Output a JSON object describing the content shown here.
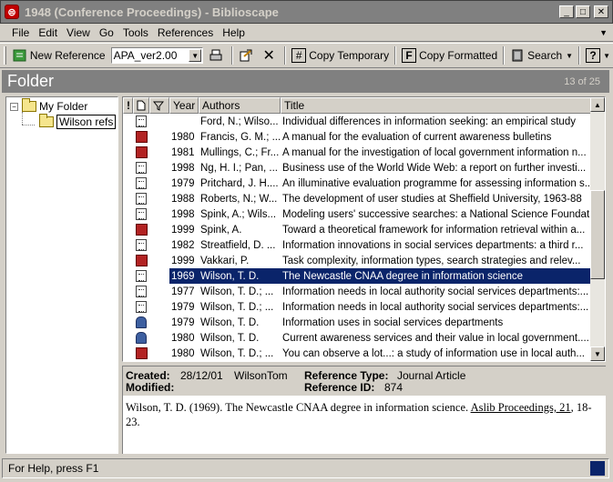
{
  "window": {
    "title": "1948  (Conference Proceedings) - Biblioscape",
    "controls": {
      "minimize": "_",
      "maximize": "□",
      "close": "✕"
    }
  },
  "menu": {
    "items": [
      {
        "label": "File"
      },
      {
        "label": "Edit"
      },
      {
        "label": "View"
      },
      {
        "label": "Go"
      },
      {
        "label": "Tools"
      },
      {
        "label": "References"
      },
      {
        "label": "Help"
      }
    ]
  },
  "toolbar": {
    "new_reference": "New Reference",
    "style_value": "APA_ver2.00",
    "copy_temporary": "Copy Temporary",
    "copy_formatted": "Copy Formatted",
    "search": "Search"
  },
  "folder": {
    "title": "Folder",
    "count": "13 of 25"
  },
  "tree": {
    "root": "My Folder",
    "child": "Wilson refs",
    "expander": "−"
  },
  "grid": {
    "headers": {
      "flag": "!",
      "type": "",
      "attach": "",
      "year": "Year",
      "authors": "Authors",
      "title": "Title"
    },
    "rows": [
      {
        "icon": "doc",
        "year": "",
        "authors": "Ford, N.; Wilso...",
        "title": "Individual differences in information seeking: an empirical study"
      },
      {
        "icon": "book",
        "year": "1980",
        "authors": "Francis, G. M.; ...",
        "title": "A manual for the evaluation of current awareness bulletins"
      },
      {
        "icon": "book",
        "year": "1981",
        "authors": "Mullings, C.; Fr...",
        "title": "A manual for the investigation of local government information n..."
      },
      {
        "icon": "doc",
        "year": "1998",
        "authors": "Ng, H. I.; Pan, ...",
        "title": "Business use of the World Wide Web: a report on further investi..."
      },
      {
        "icon": "doc",
        "year": "1979",
        "authors": "Pritchard, J. H....",
        "title": "An illuminative evaluation programme for assessing information s..."
      },
      {
        "icon": "doc",
        "year": "1988",
        "authors": "Roberts, N.; W...",
        "title": "The development of user studies at Sheffield University, 1963-88"
      },
      {
        "icon": "doc",
        "year": "1998",
        "authors": "Spink, A.; Wils...",
        "title": "Modeling users' successive searches: a National Science Foundat..."
      },
      {
        "icon": "book",
        "year": "1999",
        "authors": "Spink, A.",
        "title": "Toward a theoretical framework for information retrieval within a..."
      },
      {
        "icon": "doc",
        "year": "1982",
        "authors": "Streatfield, D. ...",
        "title": "Information innovations in social services departments: a third r..."
      },
      {
        "icon": "book",
        "year": "1999",
        "authors": "Vakkari, P.",
        "title": "Task complexity, information types, search strategies and relev..."
      },
      {
        "icon": "doc",
        "year": "1969",
        "authors": "Wilson, T. D.",
        "title": "The Newcastle CNAA degree in information science",
        "selected": true
      },
      {
        "icon": "doc",
        "year": "1977",
        "authors": "Wilson, T. D.; ...",
        "title": "Information needs in local authority social services departments:..."
      },
      {
        "icon": "doc",
        "year": "1979",
        "authors": "Wilson, T. D.; ...",
        "title": "Information needs in local authority social services departments:..."
      },
      {
        "icon": "person",
        "year": "1979",
        "authors": "Wilson, T. D.",
        "title": "Information uses in social services departments"
      },
      {
        "icon": "person",
        "year": "1980",
        "authors": "Wilson, T. D.",
        "title": "Current awareness services and their value in local government...."
      },
      {
        "icon": "book",
        "year": "1980",
        "authors": "Wilson, T. D.; ...",
        "title": "You can observe a lot...: a study of information use in local auth..."
      }
    ]
  },
  "detail": {
    "created_label": "Created:",
    "created_value": "28/12/01",
    "created_by": "WilsonTom",
    "modified_label": "Modified:",
    "ref_type_label": "Reference Type:",
    "ref_type_value": "Journal Article",
    "ref_id_label": "Reference ID:",
    "ref_id_value": "874",
    "citation_pre": "Wilson, T. D. (1969). The Newcastle CNAA degree in information science. ",
    "citation_journal": "Aslib Proceedings, 21",
    "citation_post": ", 18-23."
  },
  "status": {
    "text": "For Help, press F1"
  }
}
